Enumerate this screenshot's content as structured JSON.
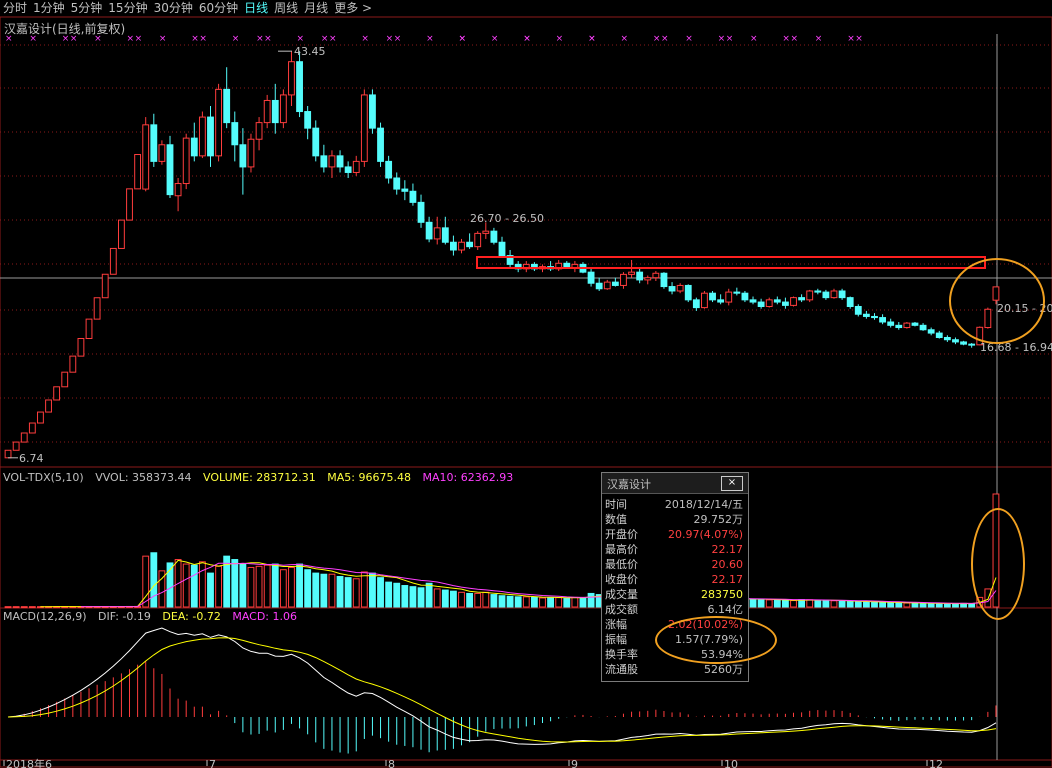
{
  "periods": [
    "分时",
    "1分钟",
    "5分钟",
    "15分钟",
    "30分钟",
    "60分钟",
    "日线",
    "周线",
    "月线",
    "更多 >"
  ],
  "active_period": "日线",
  "stock_title": "汉嘉设计(日线,前复权)",
  "price_axis": {
    "min": 6.0,
    "max": 45.0
  },
  "price_labels": {
    "high": "43.45",
    "low": "6.74",
    "resist": "26.70 - 26.50",
    "current": "20.15 - 20.",
    "bottom": "16.68 - 16.94"
  },
  "vol_legend": {
    "name": "VOL-TDX(5,10)",
    "vvol": "VVOL: 358373.44",
    "volume": "VOLUME: 283712.31",
    "ma5": "MA5: 96675.48",
    "ma10": "MA10: 62362.93"
  },
  "macd_legend": {
    "name": "MACD(12,26,9)",
    "dif": "DIF: -0.19",
    "dea": "DEA: -0.72",
    "macd": "MACD: 1.06"
  },
  "axis_dates": [
    "2018年6",
    "7",
    "8",
    "9",
    "10",
    "12"
  ],
  "popup": {
    "title": "汉嘉设计",
    "close_label": "×",
    "rows": [
      {
        "k": "时间",
        "v": "2018/12/14/五",
        "c": "#c0c0c0"
      },
      {
        "k": "数值",
        "v": "29.752万",
        "c": "#c0c0c0"
      },
      {
        "k": "开盘价",
        "v": "20.97(4.07%)",
        "c": "#ff4040"
      },
      {
        "k": "最高价",
        "v": "22.17",
        "c": "#ff4040"
      },
      {
        "k": "最低价",
        "v": "20.60",
        "c": "#ff4040"
      },
      {
        "k": "收盘价",
        "v": "22.17",
        "c": "#ff4040"
      },
      {
        "k": "成交量",
        "v": "283750",
        "c": "#ffff40"
      },
      {
        "k": "成交额",
        "v": "6.14亿",
        "c": "#c0c0c0"
      },
      {
        "k": "涨幅",
        "v": "2.02(10.02%)",
        "c": "#ff4040"
      },
      {
        "k": "振幅",
        "v": "1.57(7.79%)",
        "c": "#c0c0c0"
      },
      {
        "k": "换手率",
        "v": "53.94%",
        "c": "#c0c0c0"
      },
      {
        "k": "流通股",
        "v": "5260万",
        "c": "#c0c0c0"
      }
    ]
  },
  "colors": {
    "up": "#ff3d3d",
    "down": "#54fcfc",
    "ma5": "#ffffff",
    "ma10": "#ffff00",
    "ma20": "#ff40ff",
    "grid": "#8b1a1a",
    "highlight": "#f0a020",
    "box": "#ff2020",
    "marker": "#ff40ff"
  },
  "chart_data": {
    "type": "candlestick",
    "note_price": "daily OHLC (estimated)",
    "candles": [
      [
        6.74,
        7.42,
        6.74,
        7.42
      ],
      [
        7.42,
        8.16,
        7.42,
        8.16
      ],
      [
        8.16,
        8.98,
        8.16,
        8.98
      ],
      [
        8.98,
        9.88,
        8.98,
        9.88
      ],
      [
        9.88,
        10.87,
        9.88,
        10.87
      ],
      [
        10.87,
        11.96,
        10.87,
        11.96
      ],
      [
        11.96,
        13.15,
        11.96,
        13.15
      ],
      [
        13.15,
        14.47,
        13.15,
        14.47
      ],
      [
        14.47,
        15.92,
        14.47,
        15.92
      ],
      [
        15.92,
        17.51,
        15.92,
        17.51
      ],
      [
        17.51,
        19.26,
        17.51,
        19.26
      ],
      [
        19.26,
        21.19,
        19.26,
        21.19
      ],
      [
        21.19,
        23.31,
        21.19,
        23.31
      ],
      [
        23.31,
        25.64,
        23.31,
        25.64
      ],
      [
        25.64,
        28.2,
        25.64,
        28.2
      ],
      [
        28.2,
        31.02,
        28.2,
        31.02
      ],
      [
        31.02,
        34.12,
        31.02,
        34.12
      ],
      [
        31.0,
        37.5,
        30.8,
        36.8
      ],
      [
        36.8,
        37.8,
        33.0,
        33.5
      ],
      [
        33.5,
        35.4,
        33.2,
        35.0
      ],
      [
        35.0,
        35.8,
        30.2,
        30.5
      ],
      [
        30.4,
        32.0,
        29.0,
        31.5
      ],
      [
        31.5,
        36.0,
        31.0,
        35.6
      ],
      [
        35.6,
        37.0,
        33.5,
        34.0
      ],
      [
        34.0,
        38.0,
        33.8,
        37.5
      ],
      [
        37.5,
        38.5,
        33.0,
        34.0
      ],
      [
        34.0,
        40.5,
        33.5,
        40.0
      ],
      [
        40.0,
        42.0,
        36.5,
        37.0
      ],
      [
        37.0,
        38.0,
        33.5,
        35.0
      ],
      [
        35.0,
        36.5,
        30.5,
        33.0
      ],
      [
        33.0,
        36.0,
        32.5,
        35.5
      ],
      [
        35.5,
        37.5,
        34.5,
        37.0
      ],
      [
        37.0,
        39.5,
        36.5,
        39.0
      ],
      [
        39.0,
        40.5,
        36.0,
        37.0
      ],
      [
        37.0,
        40.0,
        36.5,
        39.5
      ],
      [
        39.5,
        43.45,
        38.5,
        42.5
      ],
      [
        42.5,
        43.45,
        37.5,
        38.0
      ],
      [
        38.0,
        38.5,
        35.5,
        36.5
      ],
      [
        36.5,
        37.2,
        33.5,
        34.0
      ],
      [
        34.0,
        35.0,
        32.5,
        33.0
      ],
      [
        33.0,
        34.5,
        32.0,
        34.0
      ],
      [
        34.0,
        34.5,
        32.5,
        33.0
      ],
      [
        33.0,
        33.5,
        32.0,
        32.5
      ],
      [
        32.5,
        34.0,
        32.2,
        33.5
      ],
      [
        33.5,
        40.0,
        33.0,
        39.5
      ],
      [
        39.5,
        40.0,
        36.0,
        36.5
      ],
      [
        36.5,
        37.0,
        33.0,
        33.5
      ],
      [
        33.5,
        34.0,
        31.5,
        32.0
      ],
      [
        32.0,
        32.5,
        30.5,
        31.0
      ],
      [
        31.0,
        31.8,
        30.0,
        30.8
      ],
      [
        30.8,
        31.5,
        29.5,
        29.8
      ],
      [
        29.8,
        30.5,
        27.5,
        28.0
      ],
      [
        28.0,
        28.5,
        26.2,
        26.5
      ],
      [
        26.5,
        28.5,
        26.0,
        27.5
      ],
      [
        27.5,
        28.5,
        26.0,
        26.2
      ],
      [
        26.2,
        26.8,
        25.0,
        25.5
      ],
      [
        25.5,
        26.5,
        25.2,
        26.2
      ],
      [
        26.2,
        27.0,
        25.6,
        25.8
      ],
      [
        25.8,
        27.2,
        25.5,
        27.0
      ],
      [
        27.0,
        28.0,
        26.5,
        27.2
      ],
      [
        27.2,
        27.5,
        26.0,
        26.2
      ],
      [
        26.2,
        26.7,
        24.8,
        25.0
      ],
      [
        25.0,
        25.5,
        23.8,
        24.2
      ],
      [
        24.2,
        24.5,
        23.5,
        23.8
      ],
      [
        23.8,
        24.5,
        23.5,
        24.2
      ],
      [
        24.2,
        24.4,
        23.6,
        23.8
      ],
      [
        23.8,
        24.2,
        23.5,
        24.0
      ],
      [
        24.0,
        24.5,
        23.6,
        23.8
      ],
      [
        23.8,
        24.6,
        23.6,
        24.3
      ],
      [
        24.3,
        24.5,
        23.8,
        23.9
      ],
      [
        23.9,
        24.5,
        23.5,
        24.2
      ],
      [
        24.2,
        24.4,
        23.4,
        23.5
      ],
      [
        23.5,
        23.8,
        22.2,
        22.5
      ],
      [
        22.5,
        23.0,
        21.8,
        22.0
      ],
      [
        22.0,
        22.8,
        21.9,
        22.6
      ],
      [
        22.6,
        23.0,
        22.2,
        22.3
      ],
      [
        22.3,
        23.5,
        22.0,
        23.3
      ],
      [
        23.3,
        24.6,
        23.0,
        23.5
      ],
      [
        23.5,
        23.8,
        22.5,
        22.8
      ],
      [
        22.8,
        23.2,
        22.4,
        23.0
      ],
      [
        23.0,
        23.6,
        22.7,
        23.4
      ],
      [
        23.4,
        23.5,
        22.0,
        22.2
      ],
      [
        22.2,
        22.6,
        21.5,
        21.8
      ],
      [
        21.8,
        22.5,
        21.6,
        22.3
      ],
      [
        22.3,
        22.4,
        20.8,
        21.0
      ],
      [
        21.0,
        21.2,
        20.0,
        20.3
      ],
      [
        20.3,
        21.8,
        20.2,
        21.6
      ],
      [
        21.6,
        21.8,
        20.8,
        21.0
      ],
      [
        21.0,
        21.5,
        20.6,
        20.8
      ],
      [
        20.8,
        22.0,
        20.5,
        21.7
      ],
      [
        21.7,
        22.1,
        21.4,
        21.6
      ],
      [
        21.6,
        21.8,
        20.8,
        21.0
      ],
      [
        21.0,
        21.3,
        20.6,
        20.8
      ],
      [
        20.8,
        21.1,
        20.2,
        20.4
      ],
      [
        20.4,
        21.2,
        20.3,
        21.0
      ],
      [
        21.0,
        21.3,
        20.6,
        20.8
      ],
      [
        20.8,
        21.2,
        20.2,
        20.5
      ],
      [
        20.5,
        21.3,
        20.4,
        21.2
      ],
      [
        21.2,
        21.5,
        20.8,
        21.0
      ],
      [
        21.0,
        21.9,
        20.8,
        21.8
      ],
      [
        21.8,
        22.0,
        21.5,
        21.7
      ],
      [
        21.7,
        21.9,
        21.0,
        21.2
      ],
      [
        21.2,
        22.0,
        21.1,
        21.8
      ],
      [
        21.8,
        22.0,
        21.0,
        21.2
      ],
      [
        21.2,
        21.3,
        20.2,
        20.4
      ],
      [
        20.4,
        20.6,
        19.5,
        19.7
      ],
      [
        19.7,
        20.0,
        19.3,
        19.5
      ],
      [
        19.5,
        19.8,
        19.2,
        19.4
      ],
      [
        19.4,
        19.7,
        18.8,
        19.0
      ],
      [
        19.0,
        19.3,
        18.5,
        18.7
      ],
      [
        18.7,
        19.0,
        18.3,
        18.5
      ],
      [
        18.5,
        19.0,
        18.4,
        18.9
      ],
      [
        18.9,
        19.0,
        18.6,
        18.7
      ],
      [
        18.7,
        18.9,
        18.2,
        18.3
      ],
      [
        18.3,
        18.5,
        17.8,
        18.0
      ],
      [
        18.0,
        18.2,
        17.5,
        17.6
      ],
      [
        17.6,
        17.8,
        17.2,
        17.4
      ],
      [
        17.4,
        17.6,
        17.0,
        17.2
      ],
      [
        17.2,
        17.3,
        16.9,
        17.0
      ],
      [
        17.0,
        17.1,
        16.68,
        16.94
      ],
      [
        16.94,
        18.6,
        16.9,
        18.52
      ],
      [
        18.5,
        20.3,
        18.4,
        20.15
      ],
      [
        20.97,
        22.17,
        20.6,
        22.17
      ]
    ],
    "volumes": [
      300,
      310,
      300,
      310,
      300,
      320,
      330,
      320,
      330,
      320,
      340,
      350,
      360,
      400,
      420,
      480,
      520,
      45000,
      48000,
      32000,
      39000,
      42000,
      38000,
      37000,
      40000,
      30000,
      36000,
      45000,
      42000,
      38000,
      35000,
      36000,
      37000,
      38000,
      33000,
      35000,
      38000,
      33000,
      30000,
      29000,
      29000,
      27000,
      26000,
      25000,
      31000,
      30000,
      26000,
      22000,
      21000,
      19000,
      18000,
      17000,
      21000,
      16000,
      15000,
      14000,
      13000,
      12000,
      12000,
      13000,
      11000,
      10000,
      9500,
      9000,
      9000,
      8500,
      8000,
      8200,
      8300,
      8000,
      8500,
      8000,
      12000,
      11000,
      10000,
      9500,
      11000,
      10000,
      9000,
      8800,
      8500,
      8000,
      8300,
      8000,
      7000,
      6800,
      7500,
      8000,
      7200,
      7000,
      7500,
      7000,
      6800,
      6500,
      6300,
      6000,
      5800,
      5700,
      6500,
      6400,
      6000,
      5800,
      5500,
      5000,
      4800,
      4600,
      4400,
      4200,
      4000,
      3800,
      3600,
      3500,
      3400,
      3200,
      3000,
      3000,
      2900,
      3000,
      3200,
      2900,
      8500,
      16000,
      100000
    ]
  }
}
